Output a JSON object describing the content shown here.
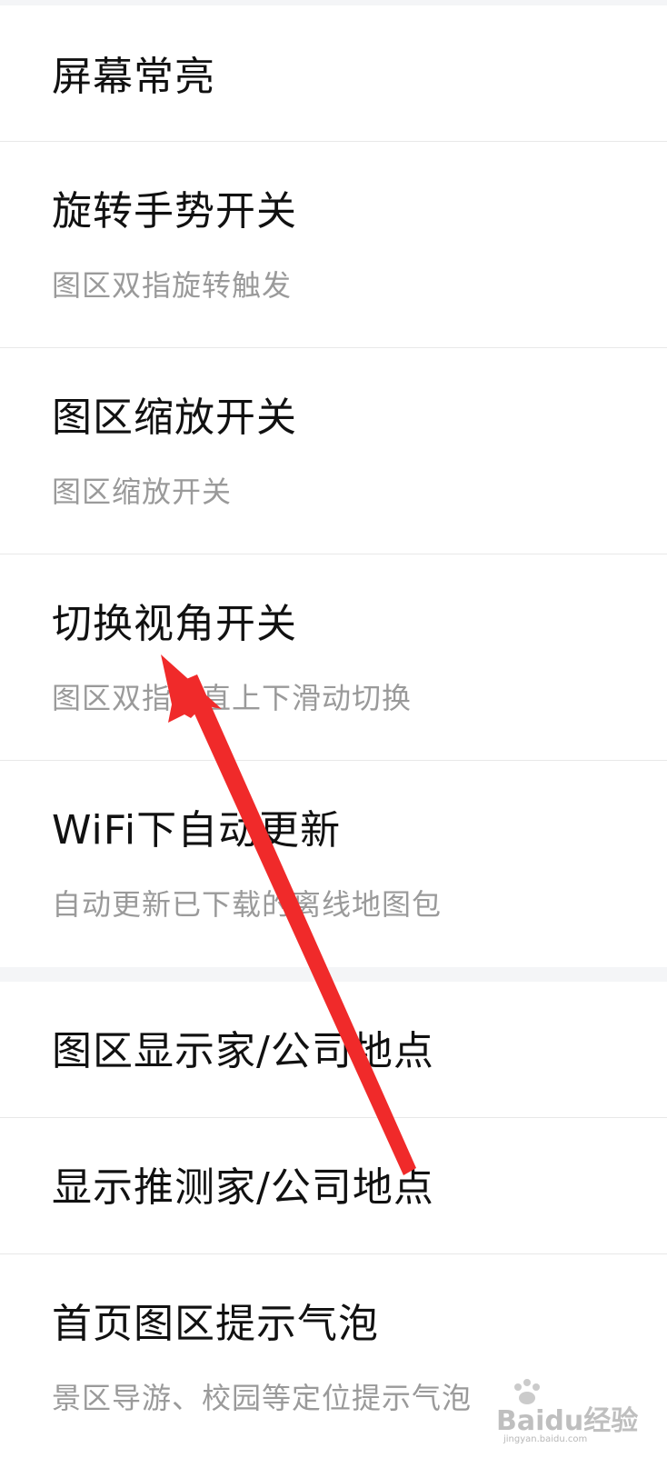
{
  "settings": {
    "screen_on": {
      "title": "屏幕常亮"
    },
    "rotate_gesture": {
      "title": "旋转手势开关",
      "subtitle": "图区双指旋转触发"
    },
    "zoom_switch": {
      "title": "图区缩放开关",
      "subtitle": "图区缩放开关"
    },
    "view_switch": {
      "title": "切换视角开关",
      "subtitle": "图区双指垂直上下滑动切换"
    },
    "wifi_update": {
      "title": "WiFi下自动更新",
      "subtitle": "自动更新已下载的离线地图包"
    },
    "show_home_company": {
      "title": "图区显示家/公司地点"
    },
    "show_inferred_home_company": {
      "title": "显示推测家/公司地点"
    },
    "home_bubble": {
      "title": "首页图区提示气泡",
      "subtitle": "景区导游、校园等定位提示气泡"
    }
  },
  "watermark": {
    "text": "Baidu经验",
    "url": "jingyan.baidu.com"
  },
  "colors": {
    "arrow": "#f02a2a",
    "title": "#111111",
    "subtitle": "#9a9a9a",
    "divider": "#e8e8e8",
    "section_gap": "#f4f5f7"
  }
}
